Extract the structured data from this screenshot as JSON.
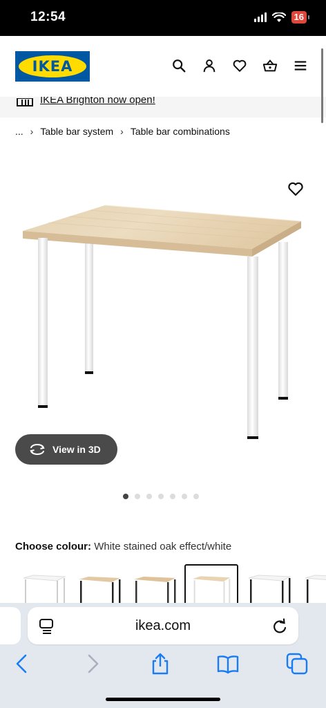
{
  "status_bar": {
    "time": "12:54",
    "battery": "16"
  },
  "header": {
    "logo_text": "IKEA"
  },
  "promo": {
    "text": "IKEA Brighton now open!"
  },
  "breadcrumb": {
    "ellipsis": "...",
    "items": [
      "Table bar system",
      "Table bar combinations"
    ]
  },
  "product": {
    "view3d_label": "View in 3D",
    "image_count": 7,
    "active_image_index": 0
  },
  "colour": {
    "label": "Choose colour:",
    "value": "White stained oak effect/white"
  },
  "browser": {
    "url": "ikea.com"
  },
  "colors": {
    "ikea_blue": "#0058a3",
    "ikea_yellow": "#ffdb00",
    "battery_red": "#e0463b",
    "safari_blue": "#1a7cf5"
  },
  "icons": [
    "search-icon",
    "profile-icon",
    "heart-icon",
    "basket-icon",
    "menu-icon",
    "store-icon",
    "rotate-3d-icon",
    "reader-icon",
    "reload-icon",
    "back-icon",
    "forward-icon",
    "share-icon",
    "bookmarks-icon",
    "tabs-icon"
  ]
}
